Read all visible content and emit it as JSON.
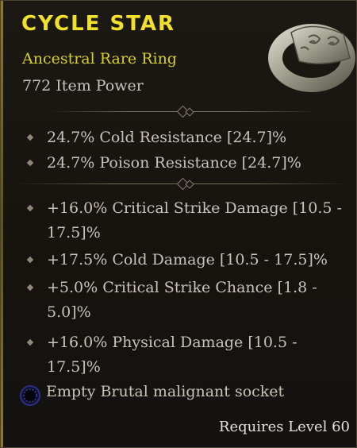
{
  "item": {
    "name": "CYCLE STAR",
    "type": "Ancestral Rare Ring",
    "item_power": "772 Item Power"
  },
  "implicits": [
    "24.7% Cold Resistance [24.7]%",
    "24.7% Poison Resistance [24.7]%"
  ],
  "affixes": [
    {
      "line1": "+16.0% Critical Strike Damage [10.5 -",
      "line2": "17.5]%"
    },
    {
      "line1": "+17.5% Cold Damage [10.5 - 17.5]%",
      "line2": ""
    },
    {
      "line1": "+5.0% Critical Strike Chance [1.8 -",
      "line2": "5.0]%"
    },
    {
      "line1": "+16.0% Physical Damage [10.5 -",
      "line2": "17.5]%"
    }
  ],
  "socket": {
    "label": "Empty Brutal malignant socket",
    "icon": "malignant-socket-icon"
  },
  "requirement": "Requires Level 60",
  "colors": {
    "title": "#f1e12a",
    "subtitle": "#d6d02c",
    "text": "#c9c3b6"
  }
}
